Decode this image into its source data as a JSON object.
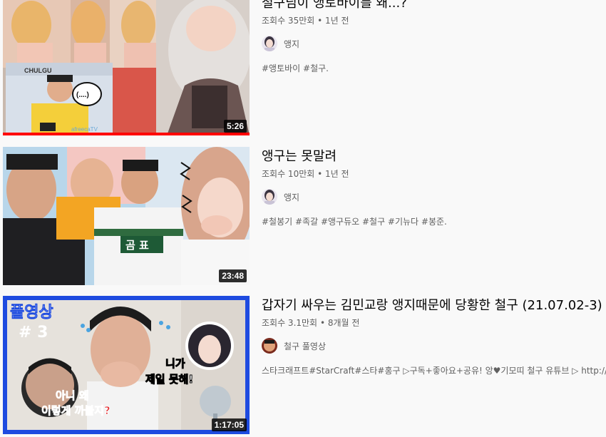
{
  "videos": [
    {
      "title": "철구님이 앵토바이를 왜...?",
      "views": "조회수 35만회",
      "age": "1년 전",
      "channel": "앵지",
      "description": "#앵토바이 #철구.",
      "duration": "5:26",
      "watched_fraction": 1.0,
      "thumb_text": [
        "CHULGU",
        "(....)",
        "afreecaTV"
      ]
    },
    {
      "title": "앵구는 못말려",
      "views": "조회수 10만회",
      "age": "1년 전",
      "channel": "앵지",
      "description": "#철봉기 #족갈 #앵구듀오 #철구 #기뉴다 #봉준.",
      "duration": "23:48",
      "thumb_text": [
        "곰 표"
      ]
    },
    {
      "title": "갑자기 싸우는 김민교랑 앵지때문에 당황한 철구 (21.07.02-3)",
      "views": "조회수 3.1만회",
      "age": "8개월 전",
      "channel": "철구 풀영상",
      "description": "스타크래프트#StarCraft#스타#홍구 ▷구독+좋아요+공유! 앙♥기모띠 철구 유튜브 ▷ http://goo.",
      "duration": "1:17:05",
      "thumb_text": [
        "풀영상",
        "# 3",
        "니가",
        "제일 못해!",
        "아니 왜",
        "이렇게 까불지?"
      ]
    }
  ],
  "separator": "•",
  "colors": {
    "progress": "#ff0000",
    "thumb3_border": "#1e4be0"
  },
  "icons": {
    "avatar_angji": "avatar-angji-icon",
    "avatar_chulgu": "avatar-chulgu-icon"
  }
}
